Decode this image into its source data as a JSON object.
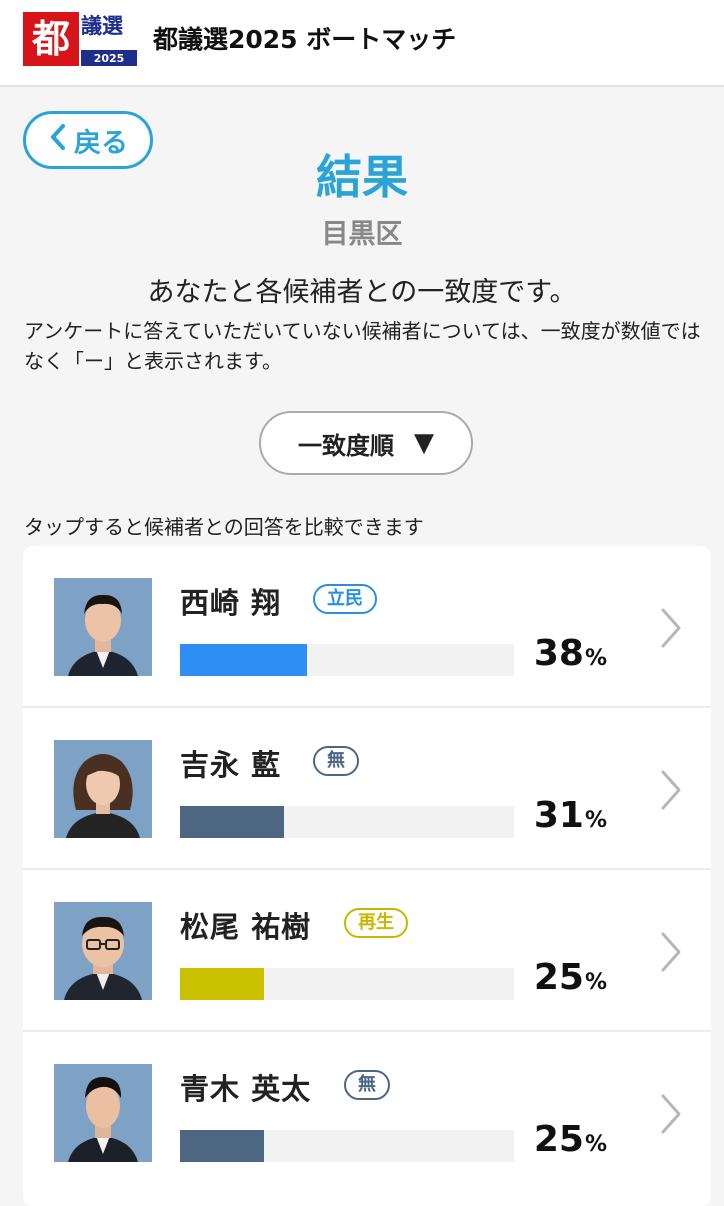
{
  "header": {
    "logo_mark": "都",
    "logo_sub": "議選",
    "logo_year": "2025",
    "title": "都議選2025 ボートマッチ"
  },
  "nav": {
    "back_label": "戻る"
  },
  "result": {
    "title": "結果",
    "district": "目黒区",
    "lead": "あなたと各候補者との一致度です。",
    "note": "アンケートに答えていただいていない候補者については、一致度が数値ではなく「ー」と表示されます。"
  },
  "sort": {
    "label": "一致度順",
    "arrow": "▼"
  },
  "hint": "タップすると候補者との回答を比較できます",
  "candidates": [
    {
      "name": "西崎 翔",
      "party": "立民",
      "party_color": "#2a8fe0",
      "bar_color": "#2f8ef2",
      "match": 38,
      "match_text": "38",
      "unit": "%"
    },
    {
      "name": "吉永 藍",
      "party": "無",
      "party_color": "#4b6684",
      "bar_color": "#4d6783",
      "match": 31,
      "match_text": "31",
      "unit": "%"
    },
    {
      "name": "松尾 祐樹",
      "party": "再生",
      "party_color": "#c9b800",
      "bar_color": "#c9c000",
      "match": 25,
      "match_text": "25",
      "unit": "%"
    },
    {
      "name": "青木 英太",
      "party": "無",
      "party_color": "#4b6684",
      "bar_color": "#4d6783",
      "match": 25,
      "match_text": "25",
      "unit": "%"
    }
  ]
}
